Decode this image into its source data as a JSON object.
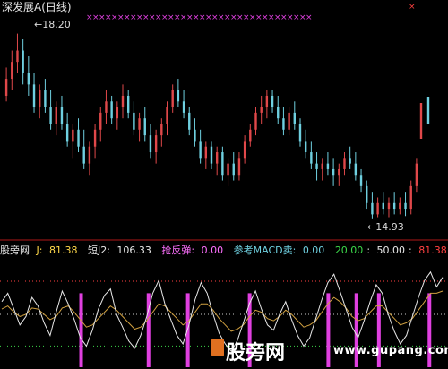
{
  "window": {
    "title": "深发展A(日线)"
  },
  "price_panel": {
    "high_label": "18.20",
    "low_label": "14.93"
  },
  "indicator": {
    "name": "股旁网",
    "j_label": "J:",
    "j_value": "81.38",
    "j2_label": "短J2:",
    "j2_value": "106.33",
    "qfd_label": "抢反弹:",
    "qfd_value": "0.00",
    "macd_label": "参考MACD卖:",
    "macd_value": "0.00",
    "ref1": "20.00",
    "ref2": "50.00",
    "ref3": "81.38",
    "sep": ":"
  },
  "watermark": {
    "text": "股旁网",
    "url": "www.gupang.com"
  },
  "colors": {
    "up": "#e0484a",
    "down": "#6fd0e0",
    "magenta": "#e040e0",
    "white_line": "#e8e8e8",
    "orange_line": "#d0a040",
    "label_yellow": "#ffd84a",
    "label_green": "#3cd84a",
    "label_red": "#ff4040",
    "label_pink": "#ff70ff"
  },
  "chart_data": {
    "type": "candlestick",
    "series_name": "深发展A(日线)",
    "y_high": 18.2,
    "y_low": 14.93,
    "candles": [
      [
        17.1,
        17.6,
        17.0,
        17.4
      ],
      [
        17.4,
        17.9,
        17.2,
        17.7
      ],
      [
        17.7,
        18.2,
        17.5,
        17.9
      ],
      [
        17.9,
        18.1,
        17.3,
        17.5
      ],
      [
        17.5,
        17.8,
        17.1,
        17.3
      ],
      [
        17.3,
        17.5,
        16.8,
        16.9
      ],
      [
        16.9,
        17.3,
        16.7,
        17.2
      ],
      [
        17.2,
        17.4,
        16.8,
        16.9
      ],
      [
        16.9,
        17.2,
        16.5,
        16.6
      ],
      [
        16.6,
        17.0,
        16.4,
        16.9
      ],
      [
        16.9,
        17.1,
        16.5,
        16.6
      ],
      [
        16.6,
        16.8,
        16.2,
        16.3
      ],
      [
        16.3,
        16.6,
        16.0,
        16.5
      ],
      [
        16.5,
        16.7,
        16.1,
        16.2
      ],
      [
        16.2,
        16.5,
        15.8,
        15.9
      ],
      [
        15.9,
        16.3,
        15.7,
        16.2
      ],
      [
        16.2,
        16.6,
        16.0,
        16.5
      ],
      [
        16.5,
        16.9,
        16.3,
        16.8
      ],
      [
        16.8,
        17.2,
        16.6,
        17.0
      ],
      [
        17.0,
        17.1,
        16.6,
        16.7
      ],
      [
        16.7,
        17.0,
        16.5,
        16.9
      ],
      [
        16.9,
        17.3,
        16.7,
        17.1
      ],
      [
        17.1,
        17.2,
        16.7,
        16.8
      ],
      [
        16.8,
        17.0,
        16.4,
        16.5
      ],
      [
        16.5,
        16.8,
        16.3,
        16.7
      ],
      [
        16.7,
        16.9,
        16.3,
        16.4
      ],
      [
        16.4,
        16.6,
        16.0,
        16.1
      ],
      [
        16.1,
        16.5,
        15.9,
        16.4
      ],
      [
        16.4,
        16.7,
        16.2,
        16.6
      ],
      [
        16.6,
        17.0,
        16.4,
        16.9
      ],
      [
        16.9,
        17.3,
        16.8,
        17.2
      ],
      [
        17.2,
        17.4,
        16.9,
        17.0
      ],
      [
        17.0,
        17.2,
        16.7,
        16.8
      ],
      [
        16.8,
        16.9,
        16.4,
        16.5
      ],
      [
        16.5,
        16.7,
        16.2,
        16.3
      ],
      [
        16.3,
        16.5,
        15.9,
        16.0
      ],
      [
        16.0,
        16.3,
        15.8,
        16.2
      ],
      [
        16.2,
        16.3,
        15.8,
        15.9
      ],
      [
        15.9,
        16.2,
        15.7,
        16.1
      ],
      [
        16.1,
        16.2,
        15.6,
        15.7
      ],
      [
        15.7,
        16.0,
        15.5,
        15.9
      ],
      [
        15.9,
        16.1,
        15.6,
        15.7
      ],
      [
        15.7,
        16.1,
        15.6,
        16.0
      ],
      [
        16.0,
        16.4,
        15.9,
        16.3
      ],
      [
        16.3,
        16.6,
        16.2,
        16.5
      ],
      [
        16.5,
        16.9,
        16.4,
        16.8
      ],
      [
        16.8,
        17.1,
        16.6,
        16.9
      ],
      [
        16.9,
        17.2,
        16.7,
        17.1
      ],
      [
        17.1,
        17.2,
        16.8,
        16.9
      ],
      [
        16.9,
        17.1,
        16.6,
        16.7
      ],
      [
        16.7,
        16.9,
        16.4,
        16.5
      ],
      [
        16.5,
        16.9,
        16.4,
        16.8
      ],
      [
        16.8,
        17.0,
        16.5,
        16.6
      ],
      [
        16.6,
        16.7,
        16.2,
        16.3
      ],
      [
        16.3,
        16.5,
        16.0,
        16.1
      ],
      [
        16.1,
        16.3,
        15.8,
        15.9
      ],
      [
        15.9,
        16.1,
        15.6,
        15.8
      ],
      [
        15.8,
        16.0,
        15.6,
        15.9
      ],
      [
        15.9,
        16.1,
        15.7,
        15.8
      ],
      [
        15.8,
        16.0,
        15.5,
        15.7
      ],
      [
        15.7,
        15.9,
        15.5,
        15.8
      ],
      [
        15.8,
        16.1,
        15.7,
        16.0
      ],
      [
        16.0,
        16.2,
        15.8,
        15.9
      ],
      [
        15.9,
        16.1,
        15.6,
        15.7
      ],
      [
        15.7,
        15.8,
        15.4,
        15.5
      ],
      [
        15.5,
        15.6,
        15.1,
        15.2
      ],
      [
        15.2,
        15.4,
        14.93,
        15.0
      ],
      [
        15.0,
        15.3,
        14.95,
        15.2
      ],
      [
        15.2,
        15.4,
        15.0,
        15.1
      ],
      [
        15.1,
        15.3,
        14.95,
        15.2
      ],
      [
        15.2,
        15.4,
        15.0,
        15.1
      ],
      [
        15.1,
        15.3,
        15.0,
        15.2
      ],
      [
        15.2,
        15.4,
        14.97,
        15.1
      ],
      [
        15.1,
        15.6,
        15.0,
        15.5
      ],
      [
        15.5,
        16.0,
        15.4,
        15.9
      ]
    ],
    "ind_white": [
      62,
      70,
      55,
      40,
      48,
      66,
      58,
      42,
      30,
      52,
      72,
      60,
      45,
      28,
      20,
      35,
      55,
      68,
      74,
      50,
      38,
      25,
      18,
      30,
      48,
      70,
      82,
      60,
      45,
      30,
      22,
      40,
      64,
      80,
      70,
      50,
      32,
      22,
      15,
      25,
      42,
      60,
      72,
      55,
      40,
      35,
      50,
      62,
      45,
      30,
      20,
      28,
      46,
      64,
      80,
      88,
      72,
      55,
      38,
      28,
      44,
      62,
      78,
      70,
      50,
      34,
      22,
      30,
      48,
      66,
      82,
      90,
      76,
      85
    ],
    "ind_orange": [
      55,
      58,
      52,
      48,
      50,
      56,
      55,
      50,
      45,
      48,
      56,
      58,
      52,
      45,
      38,
      40,
      46,
      52,
      58,
      54,
      48,
      42,
      36,
      38,
      44,
      52,
      60,
      58,
      52,
      46,
      40,
      44,
      52,
      60,
      60,
      54,
      46,
      40,
      34,
      36,
      40,
      48,
      54,
      52,
      46,
      44,
      48,
      54,
      50,
      44,
      38,
      40,
      44,
      52,
      60,
      66,
      62,
      56,
      48,
      44,
      46,
      52,
      58,
      58,
      52,
      46,
      40,
      42,
      46,
      54,
      62,
      70,
      70,
      72
    ],
    "qfd_signals": [
      13,
      25,
      32,
      43,
      57,
      62,
      66,
      75
    ]
  }
}
